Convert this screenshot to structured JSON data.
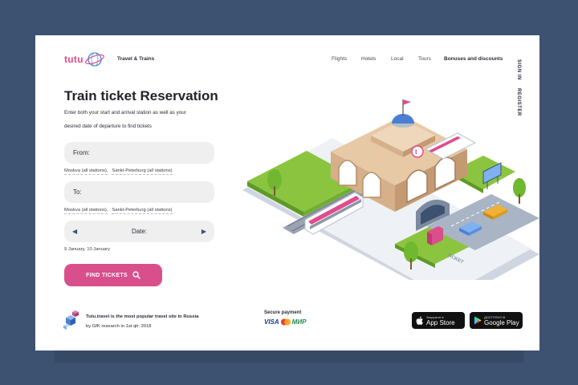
{
  "brand": {
    "logo_text": "tutu",
    "tagline": "Travel & Trains"
  },
  "nav": {
    "items": [
      "Flights",
      "Hotels",
      "Local",
      "Tours",
      "Bonuses and discounts"
    ],
    "sign_in": "SIGN IN",
    "register": "REGISTER"
  },
  "hero": {
    "title": "Train ticket Reservation",
    "subtitle_line1": "Enter both your start and arrival station as well as your",
    "subtitle_line2": "desired date of departure to find tickets"
  },
  "form": {
    "from_label": "From:",
    "from_hints": [
      "Moskva (all stations),",
      "Sankt-Peterburg (all stations)"
    ],
    "to_label": "To:",
    "to_hints": [
      "Moskva (all stations),",
      "Sankt-Peterburg (all stations)"
    ],
    "date_label": "Date:",
    "date_hint": "9 January, 10 January",
    "find_button": "FIND TICKETS"
  },
  "footer": {
    "claim_bold": "Tutu.travel is the most popular travel site in Russia",
    "claim_source": "by GfK research in 1st qtr. 2018",
    "secure_payment": "Secure payment",
    "payment_visa": "VISA",
    "payment_mir": "МИР",
    "app_store_small": "Загрузите в",
    "app_store_big": "App Store",
    "google_play_small": "ДОСТУПНО В",
    "google_play_big": "Google Play"
  },
  "illustration": {
    "ticket_sign": "TICKET"
  },
  "colors": {
    "background": "#3d5270",
    "accent": "#d94f8c",
    "field_bg": "#efefef"
  }
}
